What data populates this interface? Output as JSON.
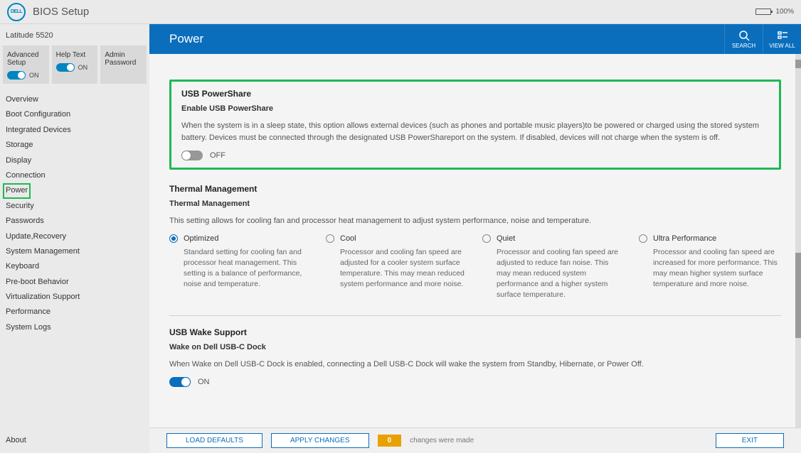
{
  "app_title": "BIOS Setup",
  "battery_pct": "100%",
  "model": "Latitude 5520",
  "quick": [
    {
      "label": "Advanced Setup",
      "toggle": "ON",
      "on": true
    },
    {
      "label": "Help Text",
      "toggle": "ON",
      "on": true
    },
    {
      "label": "Admin Password"
    }
  ],
  "nav": [
    "Overview",
    "Boot Configuration",
    "Integrated Devices",
    "Storage",
    "Display",
    "Connection",
    "Power",
    "Security",
    "Passwords",
    "Update,Recovery",
    "System Management",
    "Keyboard",
    "Pre-boot Behavior",
    "Virtualization Support",
    "Performance",
    "System Logs"
  ],
  "nav_active": "Power",
  "about": "About",
  "hero": {
    "title": "Power",
    "search": "SEARCH",
    "viewall": "VIEW ALL"
  },
  "usb_powershare": {
    "title": "USB PowerShare",
    "subtitle": "Enable USB PowerShare",
    "desc": "When the system is in a sleep state, this option allows external devices (such as phones and portable music players)to be powered or charged using the stored system battery. Devices must be connected through the designated USB PowerShareport on the system. If disabled, devices will not charge when the system is off.",
    "state": "OFF"
  },
  "thermal": {
    "title": "Thermal Management",
    "subtitle": "Thermal Management",
    "desc": "This setting allows for cooling fan and processor heat management to adjust system performance, noise and temperature.",
    "options": [
      {
        "label": "Optimized",
        "desc": "Standard setting for cooling fan and processor heat management. This setting is a balance of performance, noise and temperature.",
        "checked": true
      },
      {
        "label": "Cool",
        "desc": "Processor and cooling fan speed are adjusted for a cooler system surface temperature. This may mean reduced system performance and more noise."
      },
      {
        "label": "Quiet",
        "desc": "Processor and cooling fan speed are adjusted to reduce fan noise. This may mean reduced system performance and a higher system surface temperature."
      },
      {
        "label": "Ultra Performance",
        "desc": "Processor and cooling fan speed are increased for more performance. This may mean higher system surface temperature and more noise."
      }
    ]
  },
  "usb_wake": {
    "title": "USB Wake Support",
    "subtitle": "Wake on Dell USB-C Dock",
    "desc": "When Wake on Dell USB-C Dock is enabled, connecting a Dell USB-C Dock will wake the system from Standby, Hibernate, or Power Off.",
    "state": "ON"
  },
  "footer": {
    "load": "LOAD DEFAULTS",
    "apply": "APPLY CHANGES",
    "changes": "0",
    "changes_label": "changes were made",
    "exit": "EXIT"
  }
}
